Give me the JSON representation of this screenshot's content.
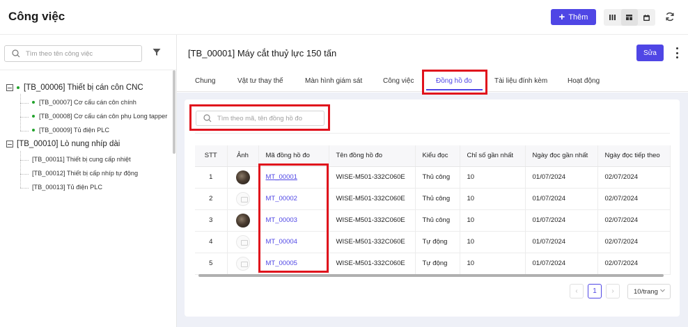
{
  "header": {
    "title": "Công việc",
    "add_label": "Thêm",
    "view_icons": [
      "columns-view-icon",
      "board-view-icon",
      "calendar-view-icon"
    ],
    "refresh_icon": "refresh-icon"
  },
  "sidebar": {
    "search_placeholder": "Tìm theo tên công việc",
    "tree": [
      {
        "label": "[TB_00006] Thiết bị cán côn CNC",
        "children": [
          {
            "label": "[TB_00007] Cơ cấu cán côn chính"
          },
          {
            "label": "[TB_00008] Cơ cấu cán côn phụ Long tapper"
          },
          {
            "label": "[TB_00009] Tủ điện PLC"
          }
        ]
      },
      {
        "label": "[TB_00010] Lò nung nhíp dài",
        "children": [
          {
            "label": "[TB_00011] Thiết bị cung cấp nhiệt"
          },
          {
            "label": "[TB_00012] Thiết bị cấp nhíp tự động"
          },
          {
            "label": "[TB_00013] Tủ điện PLC"
          }
        ]
      }
    ]
  },
  "detail": {
    "title": "[TB_00001] Máy cắt thuỷ lực 150 tấn",
    "edit_label": "Sửa",
    "tabs": [
      {
        "label": "Chung"
      },
      {
        "label": "Vật tư thay thế"
      },
      {
        "label": "Màn hình giám sát"
      },
      {
        "label": "Công việc"
      },
      {
        "label": "Đồng hồ đo"
      },
      {
        "label": "Tài liệu đính kèm"
      },
      {
        "label": "Hoạt động"
      }
    ],
    "active_tab": "Đồng hồ đo"
  },
  "gauges": {
    "search_placeholder": "Tìm theo mã, tên đồng hồ đo",
    "columns": [
      "STT",
      "Ảnh",
      "Mã đồng hồ đo",
      "Tên đồng hồ đo",
      "Kiểu đọc",
      "Chỉ số gần nhất",
      "Ngày đọc gần nhất",
      "Ngày đọc tiếp theo"
    ],
    "rows": [
      {
        "stt": "1",
        "image": "photo",
        "code": "MT_00001",
        "name": "WISE-M501-332C060E",
        "mode": "Thủ công",
        "last_value": "10",
        "last_date": "01/07/2024",
        "next_date": "02/07/2024"
      },
      {
        "stt": "2",
        "image": "placeholder",
        "code": "MT_00002",
        "name": "WISE-M501-332C060E",
        "mode": "Thủ công",
        "last_value": "10",
        "last_date": "01/07/2024",
        "next_date": "02/07/2024"
      },
      {
        "stt": "3",
        "image": "photo",
        "code": "MT_00003",
        "name": "WISE-M501-332C060E",
        "mode": "Thủ công",
        "last_value": "10",
        "last_date": "01/07/2024",
        "next_date": "02/07/2024"
      },
      {
        "stt": "4",
        "image": "placeholder",
        "code": "MT_00004",
        "name": "WISE-M501-332C060E",
        "mode": "Tự động",
        "last_value": "10",
        "last_date": "01/07/2024",
        "next_date": "02/07/2024"
      },
      {
        "stt": "5",
        "image": "placeholder",
        "code": "MT_00005",
        "name": "WISE-M501-332C060E",
        "mode": "Tự động",
        "last_value": "10",
        "last_date": "01/07/2024",
        "next_date": "02/07/2024"
      }
    ]
  },
  "pagination": {
    "current_page": "1",
    "page_size": "10/trang"
  },
  "colors": {
    "accent": "#4f46e5",
    "highlight": "#e0121c",
    "status_dot": "#22a32c"
  }
}
